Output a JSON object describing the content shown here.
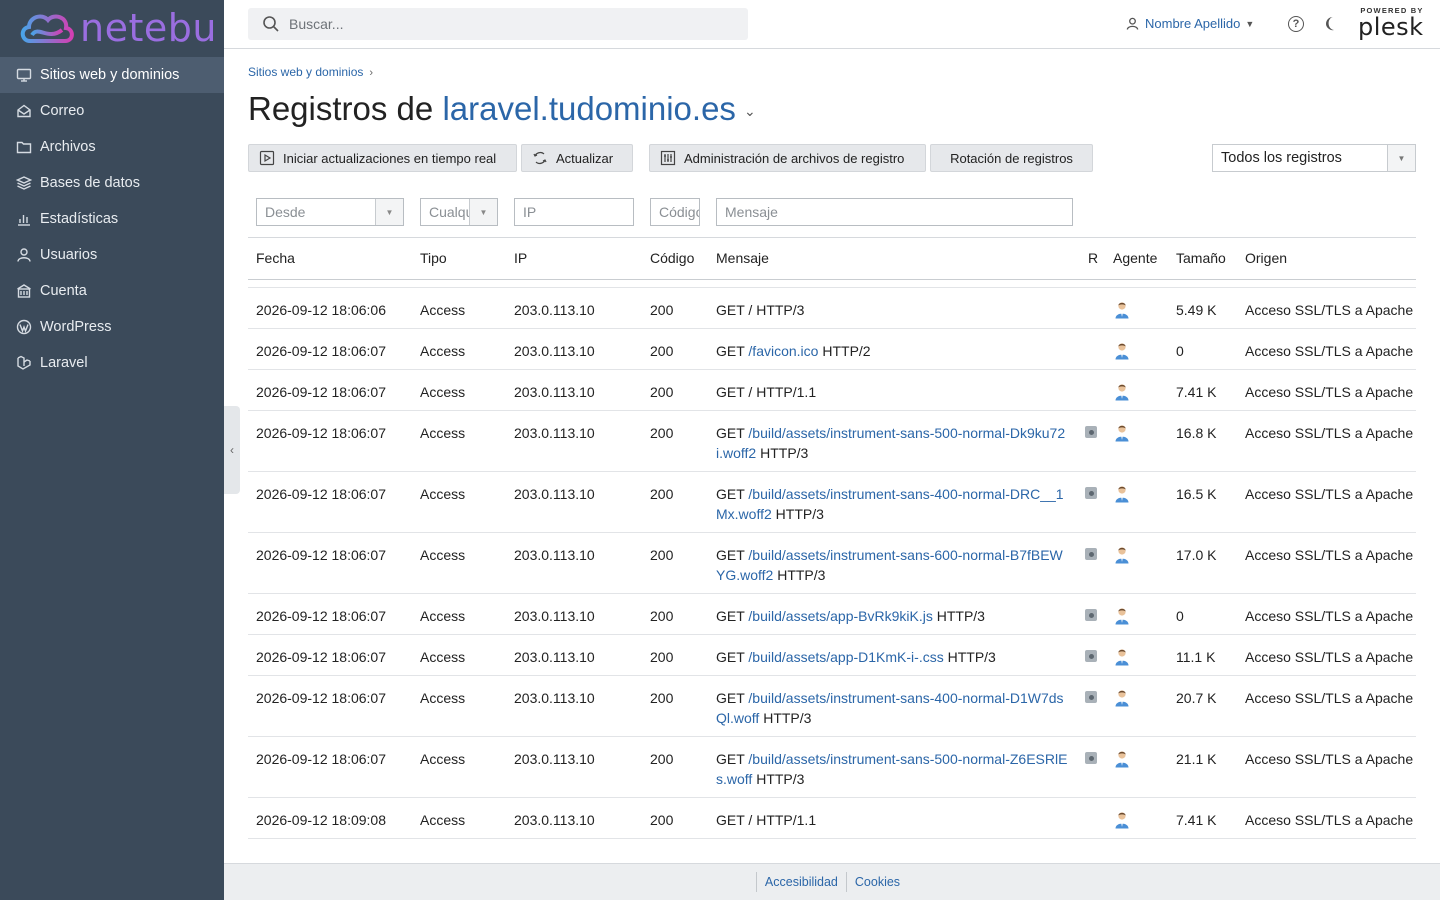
{
  "brand": {
    "name": "netebu"
  },
  "sidebar": {
    "items": [
      {
        "label": "Sitios web y dominios",
        "icon": "monitor-icon",
        "active": true
      },
      {
        "label": "Correo",
        "icon": "mail-icon"
      },
      {
        "label": "Archivos",
        "icon": "folder-icon"
      },
      {
        "label": "Bases de datos",
        "icon": "database-icon"
      },
      {
        "label": "Estadísticas",
        "icon": "chart-icon"
      },
      {
        "label": "Usuarios",
        "icon": "user-icon"
      },
      {
        "label": "Cuenta",
        "icon": "account-icon"
      },
      {
        "label": "WordPress",
        "icon": "wordpress-icon"
      },
      {
        "label": "Laravel",
        "icon": "laravel-icon"
      }
    ]
  },
  "header": {
    "search_placeholder": "Buscar...",
    "user_name": "Nombre Apellido",
    "help": "?",
    "plesk_small": "POWERED BY",
    "plesk_big": "plesk"
  },
  "breadcrumb": {
    "item": "Sitios web y dominios"
  },
  "title": {
    "prefix": "Registros de ",
    "domain": "laravel.tudominio.es"
  },
  "toolbar": {
    "realtime": "Iniciar actualizaciones en tiempo real",
    "refresh": "Actualizar",
    "manage": "Administración de archivos de registro",
    "rotation": "Rotación de registros",
    "log_select": "Todos los registros"
  },
  "filters": {
    "from": "Desde",
    "type": "Cualquiera",
    "ip": "IP",
    "code": "Código",
    "message": "Mensaje"
  },
  "table": {
    "headers": {
      "date": "Fecha",
      "type": "Tipo",
      "ip": "IP",
      "code": "Código",
      "message": "Mensaje",
      "r": "R",
      "agent": "Agente",
      "size": "Tamaño",
      "origin": "Origen"
    },
    "rows": [
      {
        "date": "2026-09-12 18:06:06",
        "type": "Access",
        "ip": "203.0.113.10",
        "code": "200",
        "method": "GET",
        "path": "",
        "plain": "/",
        "proto": "HTTP/3",
        "r": false,
        "size": "5.49 K",
        "origin": "Acceso SSL/TLS a Apache",
        "lines": 1
      },
      {
        "date": "2026-09-12 18:06:07",
        "type": "Access",
        "ip": "203.0.113.10",
        "code": "200",
        "method": "GET",
        "path": "/favicon.ico",
        "plain": "",
        "proto": "HTTP/2",
        "r": false,
        "size": "0",
        "origin": "Acceso SSL/TLS a Apache",
        "lines": 1
      },
      {
        "date": "2026-09-12 18:06:07",
        "type": "Access",
        "ip": "203.0.113.10",
        "code": "200",
        "method": "GET",
        "path": "",
        "plain": "/",
        "proto": "HTTP/1.1",
        "r": false,
        "size": "7.41 K",
        "origin": "Acceso SSL/TLS a Apache",
        "lines": 1
      },
      {
        "date": "2026-09-12 18:06:07",
        "type": "Access",
        "ip": "203.0.113.10",
        "code": "200",
        "method": "GET",
        "path": "/build/assets/instrument-sans-500-normal-Dk9ku72i.woff2",
        "plain": "",
        "proto": "HTTP/3",
        "r": true,
        "size": "16.8 K",
        "origin": "Acceso SSL/TLS a Apache",
        "lines": 2
      },
      {
        "date": "2026-09-12 18:06:07",
        "type": "Access",
        "ip": "203.0.113.10",
        "code": "200",
        "method": "GET",
        "path": "/build/assets/instrument-sans-400-normal-DRC__1Mx.woff2",
        "plain": "",
        "proto": "HTTP/3",
        "r": true,
        "size": "16.5 K",
        "origin": "Acceso SSL/TLS a Apache",
        "lines": 2
      },
      {
        "date": "2026-09-12 18:06:07",
        "type": "Access",
        "ip": "203.0.113.10",
        "code": "200",
        "method": "GET",
        "path": "/build/assets/instrument-sans-600-normal-B7fBEWYG.woff2",
        "plain": "",
        "proto": "HTTP/3",
        "r": true,
        "size": "17.0 K",
        "origin": "Acceso SSL/TLS a Apache",
        "lines": 2
      },
      {
        "date": "2026-09-12 18:06:07",
        "type": "Access",
        "ip": "203.0.113.10",
        "code": "200",
        "method": "GET",
        "path": "/build/assets/app-BvRk9kiK.js",
        "plain": "",
        "proto": "HTTP/3",
        "r": true,
        "size": "0",
        "origin": "Acceso SSL/TLS a Apache",
        "lines": 1
      },
      {
        "date": "2026-09-12 18:06:07",
        "type": "Access",
        "ip": "203.0.113.10",
        "code": "200",
        "method": "GET",
        "path": "/build/assets/app-D1KmK-i-.css",
        "plain": "",
        "proto": "HTTP/3",
        "r": true,
        "size": "11.1 K",
        "origin": "Acceso SSL/TLS a Apache",
        "lines": 1
      },
      {
        "date": "2026-09-12 18:06:07",
        "type": "Access",
        "ip": "203.0.113.10",
        "code": "200",
        "method": "GET",
        "path": "/build/assets/instrument-sans-400-normal-D1W7dsQl.woff",
        "plain": "",
        "proto": "HTTP/3",
        "r": true,
        "size": "20.7 K",
        "origin": "Acceso SSL/TLS a Apache",
        "lines": 2
      },
      {
        "date": "2026-09-12 18:06:07",
        "type": "Access",
        "ip": "203.0.113.10",
        "code": "200",
        "method": "GET",
        "path": "/build/assets/instrument-sans-500-normal-Z6ESRlEs.woff",
        "plain": "",
        "proto": "HTTP/3",
        "r": true,
        "size": "21.1 K",
        "origin": "Acceso SSL/TLS a Apache",
        "lines": 2
      },
      {
        "date": "2026-09-12 18:09:08",
        "type": "Access",
        "ip": "203.0.113.10",
        "code": "200",
        "method": "GET",
        "path": "",
        "plain": "/",
        "proto": "HTTP/1.1",
        "r": false,
        "size": "7.41 K",
        "origin": "Acceso SSL/TLS a Apache",
        "lines": 1
      }
    ]
  },
  "footer": {
    "accessibility": "Accesibilidad",
    "cookies": "Cookies"
  },
  "colors": {
    "sidebar": "#3b4a5a",
    "accent": "#2b66a8",
    "logo": "#9a6ee0"
  }
}
